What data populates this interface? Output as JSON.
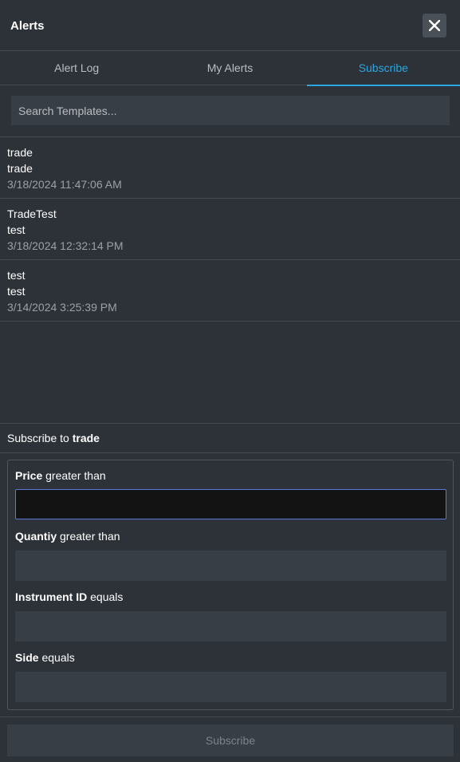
{
  "header": {
    "title": "Alerts"
  },
  "tabs": [
    {
      "label": "Alert Log"
    },
    {
      "label": "My Alerts"
    },
    {
      "label": "Subscribe"
    }
  ],
  "search": {
    "placeholder": "Search Templates..."
  },
  "templates": [
    {
      "name": "trade",
      "description": "trade",
      "timestamp": "3/18/2024 11:47:06 AM"
    },
    {
      "name": "TradeTest",
      "description": "test",
      "timestamp": "3/18/2024 12:32:14 PM"
    },
    {
      "name": "test",
      "description": "test",
      "timestamp": "3/14/2024 3:25:39 PM"
    }
  ],
  "subscribe_form": {
    "heading_prefix": "Subscribe to",
    "template_name": "trade",
    "fields": [
      {
        "field": "Price",
        "operator": "greater than",
        "value": ""
      },
      {
        "field": "Quantiy",
        "operator": "greater than",
        "value": ""
      },
      {
        "field": "Instrument ID",
        "operator": "equals",
        "value": ""
      },
      {
        "field": "Side",
        "operator": "equals",
        "value": ""
      }
    ],
    "submit_label": "Subscribe"
  },
  "colors": {
    "background": "#2d3239",
    "input": "#383e45",
    "accent": "#2aa7e0",
    "focus_border": "#5a78d6"
  }
}
